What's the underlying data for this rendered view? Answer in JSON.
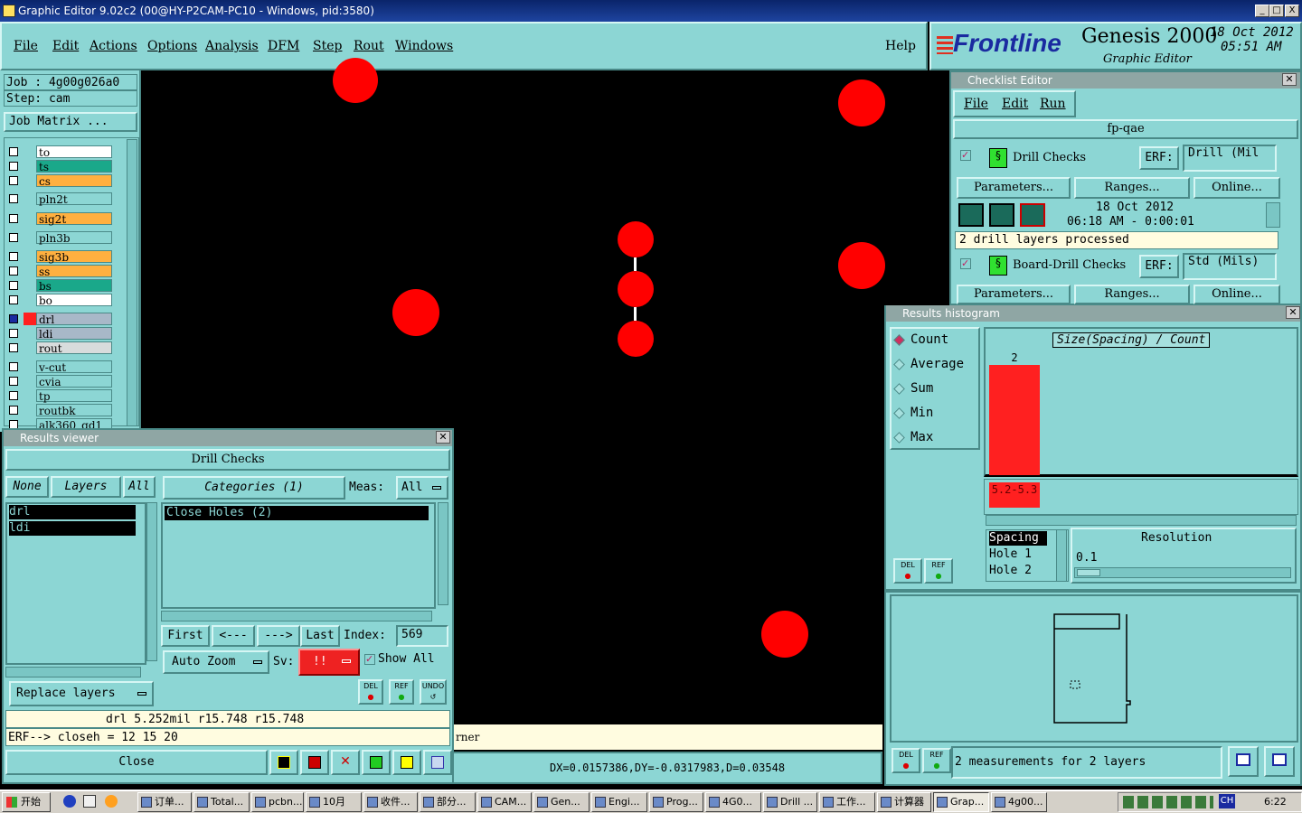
{
  "window": {
    "title": "Graphic Editor 9.02c2 (00@HY-P2CAM-PC10 - Windows, pid:3580)",
    "min": "_",
    "max": "□",
    "close": "X"
  },
  "menu": {
    "items": [
      "File",
      "Edit",
      "Actions",
      "Options",
      "Analysis",
      "DFM",
      "Step",
      "Rout",
      "Windows"
    ],
    "help": "Help"
  },
  "brand": {
    "logo": "Frontline",
    "product": "Genesis 2000",
    "subtitle": "Graphic Editor",
    "date": "18 Oct 2012",
    "time": "05:51 AM"
  },
  "job": {
    "job_label": "Job : 4g00g026a0",
    "step_label": "Step: cam",
    "matrix_button": "Job Matrix ..."
  },
  "layers": [
    {
      "name": "to",
      "color": "#ffffff"
    },
    {
      "name": "ts",
      "color": "#1aa88a"
    },
    {
      "name": "cs",
      "color": "#ffb040"
    },
    {
      "name": "pln2t",
      "color": "#8cd6d4"
    },
    {
      "name": "sig2t",
      "color": "#ffb040"
    },
    {
      "name": "pln3b",
      "color": "#8cd6d4"
    },
    {
      "name": "sig3b",
      "color": "#ffb040"
    },
    {
      "name": "ss",
      "color": "#ffb040"
    },
    {
      "name": "bs",
      "color": "#1aa88a"
    },
    {
      "name": "bo",
      "color": "#ffffff"
    },
    {
      "name": "drl",
      "color": "#a8b8c8"
    },
    {
      "name": "ldi",
      "color": "#a8b8c8"
    },
    {
      "name": "rout",
      "color": "#d8dcdc"
    },
    {
      "name": "v-cut",
      "color": "#8cd6d4"
    },
    {
      "name": "cvia",
      "color": "#8cd6d4"
    },
    {
      "name": "tp",
      "color": "#8cd6d4"
    },
    {
      "name": "routbk",
      "color": "#8cd6d4"
    },
    {
      "name": "alk360_gd1",
      "color": "#8cd6d4"
    }
  ],
  "checklist": {
    "title": "Checklist Editor",
    "menu": [
      "File",
      "Edit",
      "Run"
    ],
    "name": "fp-qae",
    "items": [
      {
        "label": "Drill Checks",
        "erf_label": "ERF:",
        "erf_value": "Drill (Mil",
        "params": "Parameters...",
        "ranges": "Ranges...",
        "online": "Online...",
        "date": "18 Oct 2012",
        "time": "06:18 AM - 0:00:01",
        "status": "2 drill layers processed"
      },
      {
        "label": "Board-Drill Checks",
        "erf_label": "ERF:",
        "erf_value": "Std (Mils)",
        "params": "Parameters...",
        "ranges": "Ranges...",
        "online": "Online..."
      }
    ]
  },
  "histogram": {
    "title": "Results histogram",
    "options": [
      "Count",
      "Average",
      "Sum",
      "Min",
      "Max"
    ],
    "selected": "Count",
    "chart_title": "Size(Spacing) / Count",
    "bar_count": "2",
    "bin_label": "5.2-5.3",
    "list_header": "Spacing",
    "list": [
      "Hole 1",
      "Hole 2"
    ],
    "resolution_label": "Resolution",
    "resolution_value": "0.1",
    "status": "2 measurements for 2 layers",
    "del": "DEL",
    "ref": "REF"
  },
  "chart_data": {
    "type": "bar",
    "categories": [
      "5.2-5.3"
    ],
    "values": [
      2
    ],
    "title": "Size(Spacing) / Count"
  },
  "results": {
    "title": "Results viewer",
    "check": "Drill Checks",
    "none": "None",
    "layers_btn": "Layers",
    "all": "All",
    "categories": "Categories (1)",
    "meas_label": "Meas:",
    "meas_value": "All",
    "layer_list": [
      "drl",
      "ldi"
    ],
    "category_list": [
      "Close Holes (2)"
    ],
    "first": "First",
    "prev": "<---",
    "next": "--->",
    "last": "Last",
    "index_label": "Index:",
    "index_value": "569",
    "auto_zoom": "Auto Zoom",
    "sv_label": "Sv:",
    "sv_value": "!!",
    "show_all": "Show All",
    "replace": "Replace layers",
    "info": "drl  5.252mil   r15.748   r15.748",
    "erf": "ERF--> closeh = 12 15 20",
    "close": "Close"
  },
  "status_bar": {
    "corner": "rner",
    "coords": "DX=0.0157386,DY=-0.0317983,D=0.03548"
  },
  "taskbar": {
    "start": "开始",
    "items": [
      "订单...",
      "Total...",
      "pcbn...",
      "10月",
      "收件...",
      "部分...",
      "CAM...",
      "Gen...",
      "Engi...",
      "Prog...",
      "4G0...",
      "Drill ...",
      "工作...",
      "计算器",
      "Grap...",
      "4g00..."
    ],
    "lang": "CH",
    "clock": "6:22"
  }
}
